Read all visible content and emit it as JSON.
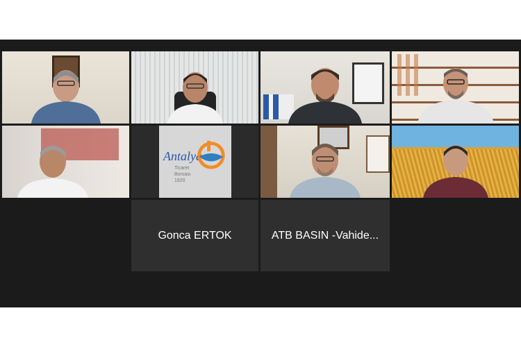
{
  "participants": [
    {
      "id": "p1",
      "kind": "video",
      "background": "office-wall-portrait",
      "shirt": "#4f6e98",
      "skin": "#c99b83",
      "hair": "#8e8e8e"
    },
    {
      "id": "p2",
      "kind": "video",
      "background": "window-blinds",
      "shirt": "#f2f2f2",
      "skin": "#b88569",
      "hair": "#2a2421"
    },
    {
      "id": "p3",
      "kind": "video",
      "background": "office-flag-portrait",
      "shirt": "#2e3236",
      "skin": "#c08a6e",
      "hair": "#3a2e26",
      "active_speaker": true
    },
    {
      "id": "p4",
      "kind": "video",
      "background": "bookshelf",
      "shirt": "#e6e6e6",
      "skin": "#c59377",
      "hair": "#6b5e55"
    },
    {
      "id": "p5",
      "kind": "video",
      "background": "red-white-wall",
      "shirt": "#f3f3f3",
      "skin": "#b78768",
      "hair": "#9b9b9b"
    },
    {
      "id": "p6",
      "kind": "logo",
      "logo_text": "Antalya",
      "logo_sub_line1": "Ticaret",
      "logo_sub_line2": "Borsası",
      "logo_year": "1920"
    },
    {
      "id": "p7",
      "kind": "video",
      "background": "office-wall-portrait",
      "shirt": "#a8b8c6",
      "skin": "#bf8d72",
      "hair": "#6d5c4f"
    },
    {
      "id": "p8",
      "kind": "video",
      "background": "wheat-field",
      "shirt": "#6b2c35",
      "skin": "#c79a80",
      "hair": "#2f2a27"
    }
  ],
  "name_tiles": [
    {
      "id": "n1",
      "label": "Gonca ERTOK"
    },
    {
      "id": "n2",
      "label": "ATB BASIN -Vahide..."
    }
  ],
  "colors": {
    "grid_bg": "#1b1b1b",
    "tile_bg": "#2f2f2f",
    "active_border": "#d6e26a",
    "name_text": "#ffffff"
  }
}
